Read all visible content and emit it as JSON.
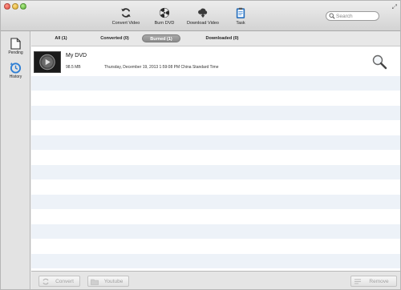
{
  "toolbar": {
    "items": [
      {
        "label": "Convert Video",
        "icon": "refresh-icon"
      },
      {
        "label": "Burn DVD",
        "icon": "burn-disc-icon"
      },
      {
        "label": "Download Video",
        "icon": "cloud-download-icon"
      },
      {
        "label": "Task",
        "icon": "clipboard-icon"
      }
    ],
    "search_placeholder": "Search"
  },
  "sidebar": {
    "items": [
      {
        "label": "Pending",
        "icon": "document-icon"
      },
      {
        "label": "History",
        "icon": "history-clock-icon"
      }
    ]
  },
  "tabs": [
    {
      "label": "All (1)",
      "active": false
    },
    {
      "label": "Converted (0)",
      "active": false
    },
    {
      "label": "Burned (1)",
      "active": true
    },
    {
      "label": "Downloaded (0)",
      "active": false
    }
  ],
  "list": {
    "rows": [
      {
        "title": "My DVD",
        "size": "98.5 MB",
        "date": "Thursday, December 19, 2013 1:59:08 PM China Standard Time"
      }
    ]
  },
  "bottom": {
    "convert_label": "Convert",
    "youtube_label": "Youtube",
    "remove_label": "Remove"
  },
  "colors": {
    "accent": "#2f7fd4",
    "row_stripe": "#edf2f8"
  }
}
